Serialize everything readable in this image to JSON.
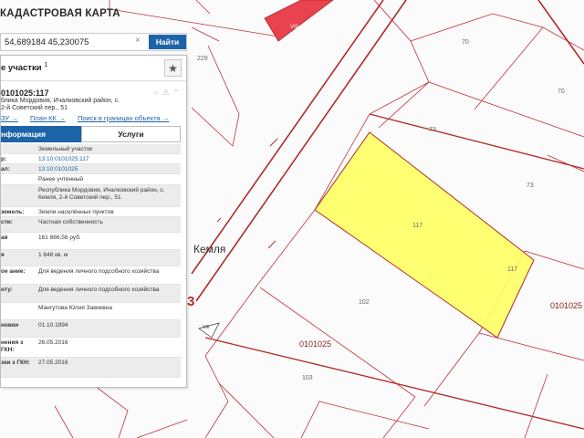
{
  "app": {
    "title": "КАДАСТРОВАЯ КАРТА"
  },
  "search": {
    "value": "54,689184 45,230075",
    "clear_icon": "close-icon",
    "button_label": "Найти"
  },
  "panel": {
    "title": "е участки",
    "count": "1",
    "star_icon": "star-icon",
    "parcel": {
      "id": "0101025:117",
      "icons": "☆ ⚠ ⌃",
      "address_lines": [
        "блика Мордовия, Ичалковский район, с.",
        "2-й Советский пер., 51"
      ],
      "links": {
        "zu": "ЗУ →",
        "plan": "План КК →",
        "search": "Поиск в границах объекта →"
      }
    },
    "tabs": {
      "info": "нформация",
      "services": "Услуги"
    },
    "rows": [
      {
        "k": "",
        "v": "Земельный участок"
      },
      {
        "k": "р:",
        "v": "13:10:0101025:117"
      },
      {
        "k": "ал:",
        "v": "13:10:0101025"
      },
      {
        "k": "",
        "v": "Ранее учтенный"
      },
      {
        "k": "",
        "v": "Республика Мордовия, Ичалковский район, с. Кемля, 2-й Советский пер., 51"
      },
      {
        "k": "земель:",
        "v": "Земли населённых пунктов"
      },
      {
        "k": "сти:",
        "v": "Частная собственность"
      },
      {
        "k": "ая",
        "v": "161 866,56 руб."
      },
      {
        "k": "я",
        "v": "1 648 кв. м"
      },
      {
        "k": "ое ание:",
        "v": "Для ведения личного подсобного хозяйства"
      },
      {
        "k": "нту:",
        "v": "Для ведения личного подсобного хозяйства"
      },
      {
        "k": "",
        "v": "Мангутова Юлия Закиевна"
      },
      {
        "k": "новки",
        "v": "01.10.1994"
      },
      {
        "k": "нения з ГКН:",
        "v": "26.05.2016"
      },
      {
        "k": "зки з ГКН:",
        "v": "27.05.2016"
      }
    ]
  },
  "map": {
    "village": "Кемля",
    "quarter_left": "0101025",
    "quarter_right": "0101025",
    "big_number": "3",
    "road_marker": "VIII",
    "plot_numbers": {
      "p229": "229",
      "p70a": "70",
      "p70b": "70",
      "p73a": "73",
      "p73b": "73",
      "p117a": "117",
      "p117b": "117",
      "p102": "102",
      "p103": "103"
    },
    "colors": {
      "selected_parcel": "#ffff66",
      "boundary": "#c0303a",
      "road_edge": "#b12a2a",
      "accent": "#1c63a8"
    }
  }
}
